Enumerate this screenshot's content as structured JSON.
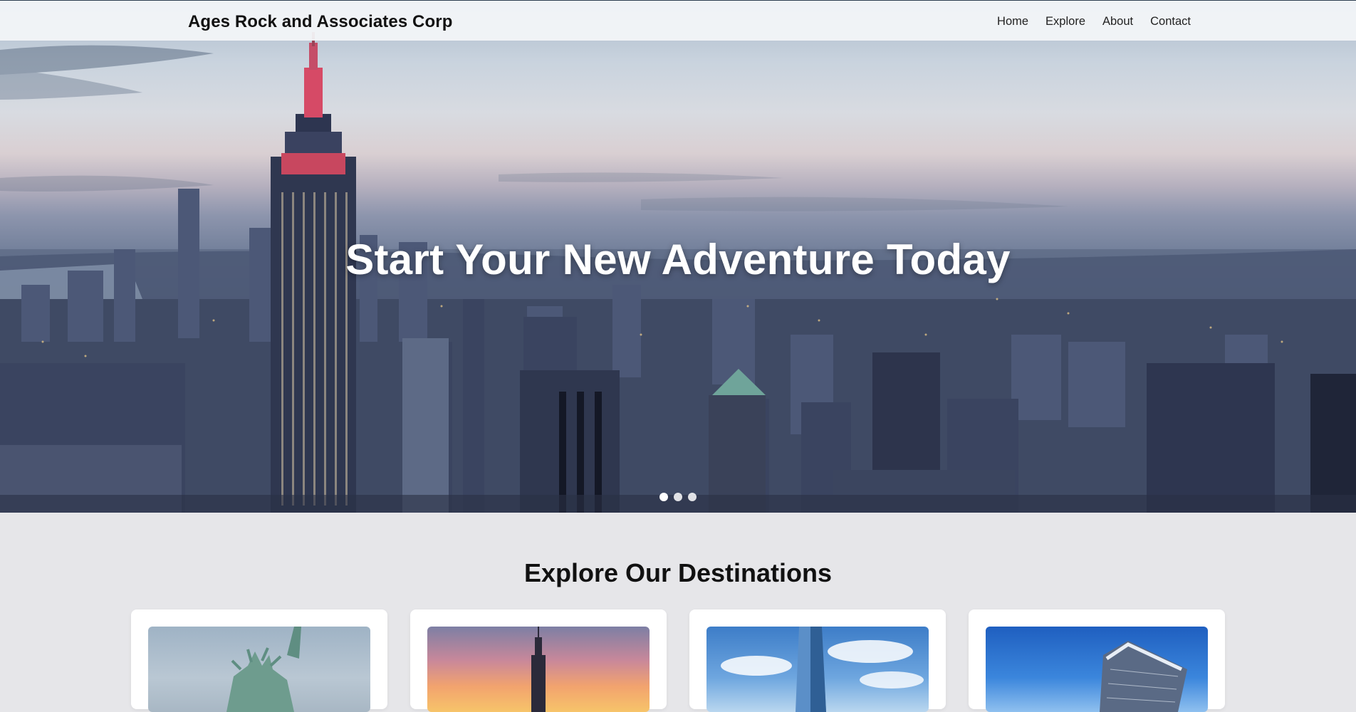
{
  "nav": {
    "brand": "Ages Rock and Associates Corp",
    "links": [
      "Home",
      "Explore",
      "About",
      "Contact"
    ]
  },
  "hero": {
    "title": "Start Your New Adventure Today",
    "slide_count": 3,
    "active_slide": 1
  },
  "destinations": {
    "title": "Explore Our Destinations",
    "cards": [
      {
        "image": "statue-of-liberty-photo"
      },
      {
        "image": "empire-state-sunset-photo"
      },
      {
        "image": "one-world-trade-center-photo"
      },
      {
        "image": "hudson-yards-edge-photo"
      }
    ]
  },
  "colors": {
    "page_background": "#e6e6e9",
    "navbar_background": "#f4f6f9",
    "hero_text": "#ffffff"
  }
}
